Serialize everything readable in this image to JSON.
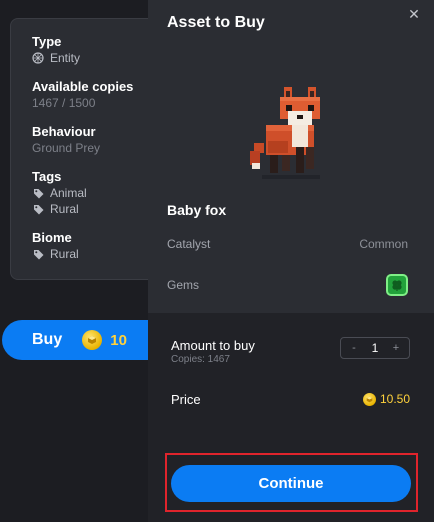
{
  "background": {
    "info": {
      "type_label": "Type",
      "type_value": "Entity",
      "copies_label": "Available copies",
      "copies_value": "1467 / 1500",
      "behaviour_label": "Behaviour",
      "behaviour_value": "Ground Prey",
      "tags_label": "Tags",
      "tags": [
        "Animal",
        "Rural"
      ],
      "biome_label": "Biome",
      "biome_value": "Rural"
    },
    "buy_button": {
      "label": "Buy",
      "price": "10",
      "icon": "coin-icon"
    }
  },
  "modal": {
    "title": "Asset to Buy",
    "close_icon": "close-icon",
    "asset": {
      "name": "Baby fox",
      "image": "pixel-fox-image"
    },
    "catalyst_label": "Catalyst",
    "catalyst_value": "Common",
    "gems_label": "Gems",
    "gems_icon": "clover-gem-icon",
    "amount_label": "Amount to buy",
    "copies_label": "Copies: 1467",
    "quantity": "1",
    "decrement": "-",
    "increment": "+",
    "price_label": "Price",
    "price_value": "10.50",
    "continue_label": "Continue"
  },
  "colors": {
    "accent": "#0b7cf3",
    "panel": "#2b2d33",
    "highlight_border": "#e0242c",
    "price": "#ffd23c",
    "gem": "#22a23b"
  }
}
